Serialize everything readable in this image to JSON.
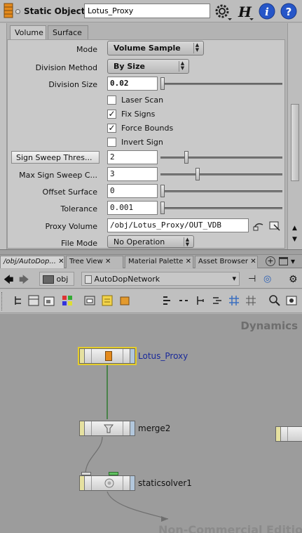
{
  "header": {
    "node_type": "Static Object",
    "node_name": "Lotus_Proxy"
  },
  "param_tabs": [
    "Volume",
    "Surface"
  ],
  "params": {
    "mode_label": "Mode",
    "mode_value": "Volume Sample",
    "division_method_label": "Division Method",
    "division_method_value": "By Size",
    "division_size_label": "Division Size",
    "division_size_value": "0.02",
    "laser_scan_label": "Laser Scan",
    "laser_scan_checked": false,
    "fix_signs_label": "Fix Signs",
    "fix_signs_checked": true,
    "force_bounds_label": "Force Bounds",
    "force_bounds_checked": true,
    "invert_sign_label": "Invert Sign",
    "invert_sign_checked": false,
    "sign_sweep_label": "Sign Sweep Thres...",
    "sign_sweep_value": "2",
    "max_sign_sweep_label": "Max Sign Sweep C...",
    "max_sign_sweep_value": "3",
    "offset_surface_label": "Offset Surface",
    "offset_surface_value": "0",
    "tolerance_label": "Tolerance",
    "tolerance_value": "0.001",
    "proxy_volume_label": "Proxy Volume",
    "proxy_volume_value": "/obj/Lotus_Proxy/OUT_VDB",
    "file_mode_label": "File Mode",
    "file_mode_value": "No Operation"
  },
  "slider_levels": {
    "division_size": 0.0,
    "sign_sweep": 0.2,
    "max_sign_sweep": 0.3,
    "offset_surface": 0.0,
    "tolerance": 0.0
  },
  "pane_tabs": [
    "/obj/AutoDop...",
    "Tree View",
    "Material Palette",
    "Asset Browser"
  ],
  "path": {
    "root": "obj",
    "current": "AutoDopNetwork"
  },
  "network": {
    "context": "Dynamics",
    "watermark": "Non-Commercial Edition",
    "nodes": [
      "Lotus_Proxy",
      "merge2",
      "staticsolver1"
    ]
  },
  "colors": {
    "selection": "#e5cd2a",
    "wire_green": "#2f7a2f",
    "name_blue": "#1a2a9a",
    "help_blue": "#2656c8"
  }
}
